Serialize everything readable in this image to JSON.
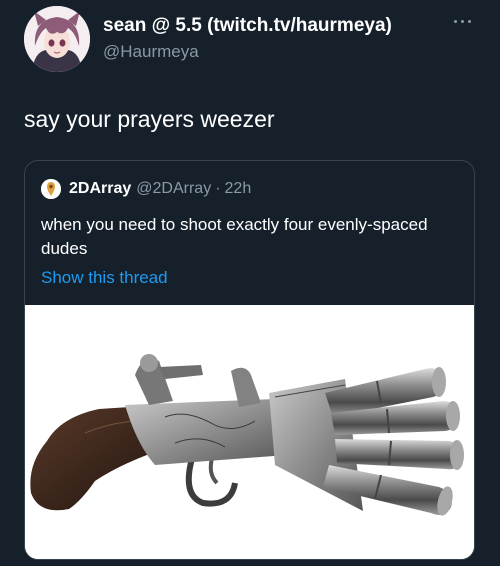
{
  "author": {
    "display_name": "sean @ 5.5 (twitch.tv/haurmeya)",
    "handle": "@Haurmeya",
    "avatar_icon": "anime-avatar"
  },
  "tweet": {
    "text": "say your prayers weezer"
  },
  "quoted": {
    "display_name": "2DArray",
    "handle": "@2DArray",
    "separator": "·",
    "time": "22h",
    "text": "when you need to shoot exactly four evenly-spaced dudes",
    "show_thread": "Show this thread",
    "avatar_icon": "pin-avatar",
    "media_icon": "duck-foot-pistol-image"
  },
  "colors": {
    "background": "#15202b",
    "link": "#1d9bf0",
    "secondary_text": "#8b98a5",
    "border": "#38444d"
  }
}
